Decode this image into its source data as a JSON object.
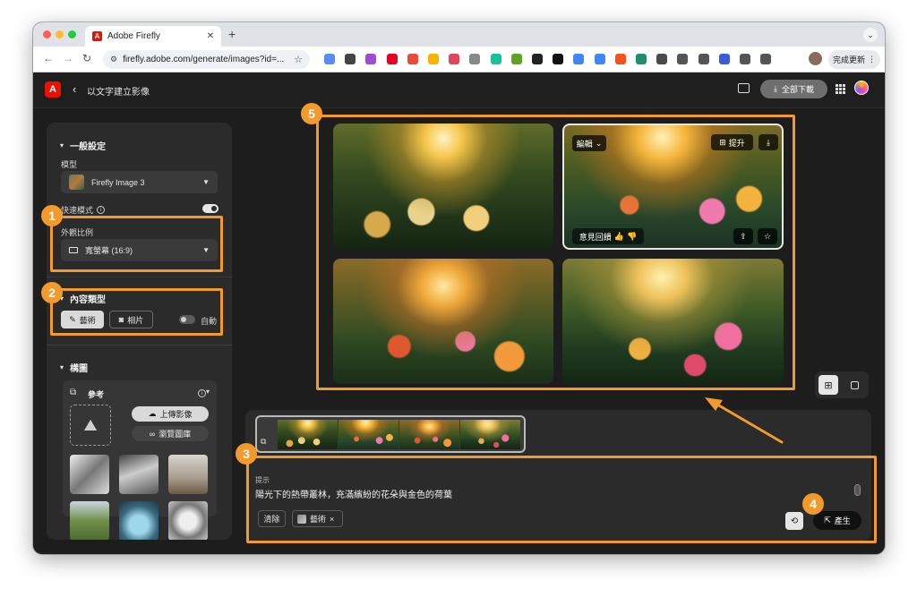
{
  "browser": {
    "tab_title": "Adobe Firefly",
    "url": "firefly.adobe.com/generate/images?id=...",
    "update_label": "完成更新",
    "extension_icons": [
      "cloud-icon",
      "translate-icon",
      "reader-icon",
      "pinterest-icon",
      "rocket-icon",
      "notes-icon",
      "pocket-icon",
      "camera-icon",
      "grammar-icon",
      "new-badge-icon",
      "font-icon",
      "notion-icon",
      "sync-icon",
      "chrome-icon",
      "vpn-icon",
      "sheet-icon",
      "folder-icon",
      "share-icon",
      "copy-icon",
      "face-icon",
      "puzzle-icon",
      "sidebar-icon"
    ],
    "extension_colors": [
      "#5b8def",
      "#444",
      "#a24bd0",
      "#e60023",
      "#e94a3a",
      "#f5b400",
      "#e2445c",
      "#888",
      "#15c39a",
      "#5ca524",
      "#222",
      "#111",
      "#4285f4",
      "#4285f4",
      "#f4511e",
      "#1d8f6c",
      "#4a4a4a",
      "#555",
      "#555",
      "#3b5bdb",
      "#555",
      "#555"
    ]
  },
  "header": {
    "back_label": "以文字建立影像",
    "download_all_label": "全部下載"
  },
  "sidebar": {
    "general_title": "一般設定",
    "model_label": "模型",
    "model_value": "Firefly Image 3",
    "fast_mode_label": "快速模式",
    "fast_mode_on": true,
    "aspect_label": "外觀比例",
    "aspect_value": "寬螢幕 (16:9)",
    "content_type_title": "內容類型",
    "content_art": "藝術",
    "content_photo": "相片",
    "content_auto": "自動",
    "composition_title": "構圖",
    "reference_label": "參考",
    "upload_label": "上傳影像",
    "browse_label": "瀏覽圖庫"
  },
  "images": {
    "edit_label": "編輯",
    "upscale_label": "提升",
    "feedback_label": "意見回饋"
  },
  "prompt": {
    "label": "提示",
    "text": "陽光下的熱帶叢林，充滿繽紛的花朵與金色的荷葉",
    "clear_label": "清除",
    "style_chip": "藝術",
    "generate_label": "產生"
  },
  "annotations": [
    "1",
    "2",
    "3",
    "4",
    "5"
  ],
  "colors": {
    "accent_orange": "#f39a2d",
    "adobe_red": "#eb1000",
    "panel": "#2b2b2b",
    "app_bg": "#1d1d1d"
  }
}
